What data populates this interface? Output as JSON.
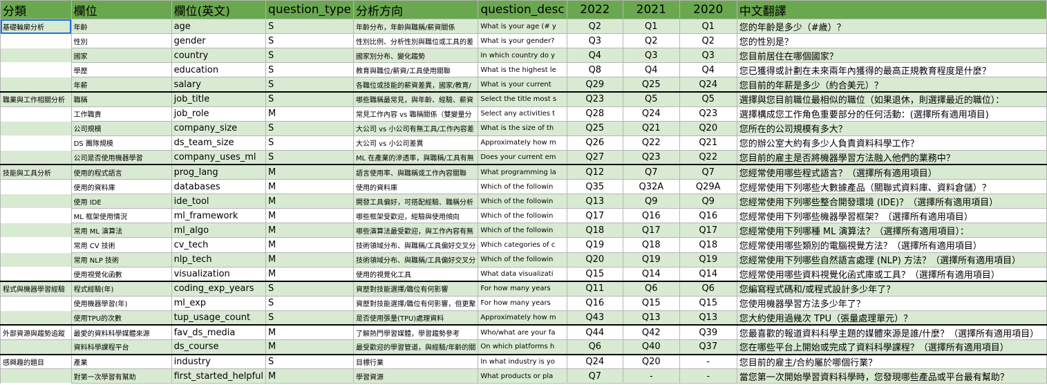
{
  "headers": [
    "分類",
    "欄位",
    "欄位(英文)",
    "question_type",
    "分析方向",
    "question_desc",
    "2022",
    "2021",
    "2020",
    "中文翻譯"
  ],
  "rows": [
    [
      "基礎輪廓分析",
      "年齡",
      "age",
      "S",
      "年齡分布，年齡與職稱/薪資關係",
      "What is your age (# y",
      "Q2",
      "Q1",
      "Q1",
      "您的年齡是多少（#歲）？"
    ],
    [
      "",
      "性別",
      "gender",
      "S",
      "性別比例、分析性別與職位或工具的差",
      "What is your gender?",
      "Q3",
      "Q2",
      "Q2",
      "您的性別是？"
    ],
    [
      "",
      "國家",
      "country",
      "S",
      "國家別分布、變化趨勢",
      "In which country do y",
      "Q4",
      "Q3",
      "Q3",
      "您目前居住在哪個國家？"
    ],
    [
      "",
      "學歷",
      "education",
      "S",
      "教育與職位/薪資/工具使用關聯",
      "What is the highest le",
      "Q8",
      "Q4",
      "Q4",
      "您已獲得或計劃在未來兩年內獲得的最高正規教育程度是什麼？"
    ],
    [
      "",
      "年薪",
      "salary",
      "S",
      "各職位或技能的薪資差異，國家/教育/",
      "What is your current",
      "Q29",
      "Q25",
      "Q24",
      "您目前的年薪是多少（約合美元）？"
    ],
    [
      "職業與工作相關分析",
      "職稱",
      "job_title",
      "S",
      "哪些職稱最常見，與年齡、經驗、薪資",
      "Select the title most s",
      "Q23",
      "Q5",
      "Q5",
      "選擇與您目前職位最相似的職位（如果退休，則選擇最近的職位）："
    ],
    [
      "",
      "工作職責",
      "job_role",
      "M",
      "常見工作內容 vs 職稱關係（雙變量分",
      "Select any activities t",
      "Q28",
      "Q24",
      "Q23",
      "選擇構成您工作角色重要部分的任何活動：(選擇所有適用項目)"
    ],
    [
      "",
      "公司規模",
      "company_size",
      "S",
      "大公司 vs 小公司有無工具/工作內容差",
      "What is the size of th",
      "Q25",
      "Q21",
      "Q20",
      "您所在的公司規模有多大？"
    ],
    [
      "",
      "DS 團隊規模",
      "ds_team_size",
      "S",
      "大公司 vs 小公司差異",
      "Approximately how m",
      "Q26",
      "Q22",
      "Q21",
      "您的辦公室大約有多少人負責資料科學工作？"
    ],
    [
      "",
      "公司是否使用機器學習",
      "company_uses_ml",
      "S",
      "ML 在產業的滲透率，與職稱/工具有無",
      "Does your current em",
      "Q27",
      "Q23",
      "Q22",
      "您目前的雇主是否將機器學習方法融入他們的業務中？"
    ],
    [
      "技能與工具分析",
      "使用的程式語言",
      "prog_lang",
      "M",
      "語言使用率、與職稱或工作內容關聯",
      "What programming la",
      "Q12",
      "Q7",
      "Q7",
      "您經常使用哪些程式語言？（選擇所有適用項目）"
    ],
    [
      "",
      "使用的資料庫",
      "databases",
      "M",
      "使用的資料庫",
      "Which of the followin",
      "Q35",
      "Q32A",
      "Q29A",
      "您經常使用下列哪些大數據產品（關聯式資料庫、資料倉儲）？"
    ],
    [
      "",
      "使用 IDE",
      "ide_tool",
      "M",
      "開發工具偏好，可搭配經驗、職稱分析",
      "Which of the followin",
      "Q13",
      "Q9",
      "Q9",
      "您經常使用下列哪些整合開發環境 (IDE)？（選擇所有適用項目）"
    ],
    [
      "",
      "ML 框架使用情況",
      "ml_framework",
      "M",
      "哪些框架受歡迎，經驗與使用傾向",
      "Which of the followin",
      "Q17",
      "Q16",
      "Q16",
      "您經常使用下列哪些機器學習框架？（選擇所有適用項目）"
    ],
    [
      "",
      "常用 ML 演算法",
      "ml_algo",
      "M",
      "哪些演算法最受歡迎，與工作內容有無",
      "Which of the followin",
      "Q18",
      "Q17",
      "Q17",
      "您經常使用下列哪種 ML 演算法？（選擇所有適用項目）："
    ],
    [
      "",
      "常用 CV 技術",
      "cv_tech",
      "M",
      "技術領域分布、與職稱/工具偏好交叉分",
      "Which categories of c",
      "Q19",
      "Q18",
      "Q18",
      "您經常使用哪些類別的電腦視覺方法？（選擇所有適用項目）"
    ],
    [
      "",
      "常用 NLP 技術",
      "nlp_tech",
      "M",
      "技術領域分布、與職稱/工具偏好交叉分",
      "Which of the followin",
      "Q20",
      "Q19",
      "Q19",
      "您經常使用下列哪些自然語言處理 (NLP) 方法？（選擇所有適用項目）"
    ],
    [
      "",
      "使用視覺化函數",
      "visualization",
      "M",
      "使用的視覺化工具",
      "What data visualizati",
      "Q15",
      "Q14",
      "Q14",
      "您經常使用哪些資料視覺化函式庫或工具？（選擇所有適用項目）"
    ],
    [
      "程式與機器學習經驗",
      "程式經驗(年)",
      "coding_exp_years",
      "S",
      "資歷對技能選擇/職位有何影響",
      "For how many years",
      "Q11",
      "Q6",
      "Q6",
      "您編寫程式碼和/或程式設計多少年了？"
    ],
    [
      "",
      "使用機器學習(年)",
      "ml_exp",
      "S",
      "資歷對技能選擇/職位有何影響，但更聚",
      "For how many years",
      "Q16",
      "Q15",
      "Q15",
      "您使用機器學習方法多少年了？"
    ],
    [
      "",
      "使用TPU的次數",
      "tup_usage_count",
      "S",
      "是否使用張量(TPU)處理資料",
      "Approximately how m",
      "Q43",
      "Q13",
      "Q13",
      "您大約使用過幾次 TPU（張量處理單元）？"
    ],
    [
      "外部資源與趨勢追蹤",
      "最愛的資料科學媒體來源",
      "fav_ds_media",
      "M",
      "了解熱門學習媒體，學習趨勢參考",
      "Who/what are your fa",
      "Q44",
      "Q42",
      "Q39",
      "您最喜歡的報道資料科學主題的媒體來源是誰/什麼？（選擇所有適用項目）"
    ],
    [
      "",
      "資料科學課程平台",
      "ds_course",
      "M",
      "最受歡迎的學習管道，與經驗/年齡的關",
      "On which platforms h",
      "Q6",
      "Q40",
      "Q37",
      "您在哪些平台上開始或完成了資料科學課程？（選擇所有適用項目）"
    ],
    [
      "感興趣的題目",
      "產業",
      "industry",
      "S",
      "目標行業",
      "In what industry is yo",
      "Q24",
      "Q20",
      "-",
      "您目前的雇主/合約屬於哪個行業？"
    ],
    [
      "",
      "對第一次學習有幫助",
      "first_started_helpful",
      "M",
      "學習資源",
      "What products or pla",
      "Q7",
      "-",
      "-",
      "當您第一次開始學習資料科學時，您發現哪些產品或平台最有幫助？"
    ]
  ],
  "shaded_rows": [
    0,
    2,
    4,
    5,
    7,
    9,
    10,
    12,
    14,
    16,
    18,
    20,
    22,
    24
  ],
  "group_start_rows": [
    5,
    10,
    18,
    21,
    23
  ],
  "selected_cell": "A2",
  "colors": {
    "header_bg": "#6aa84f",
    "shaded_row_bg": "#d9ead3",
    "selection_border": "#1a73e8",
    "grid_line": "#b5b5b5"
  }
}
